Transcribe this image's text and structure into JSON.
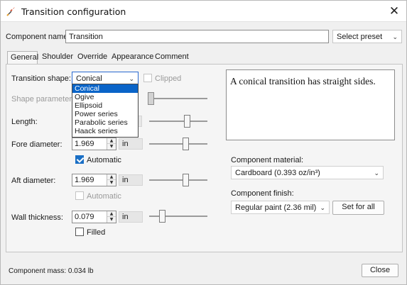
{
  "window": {
    "title": "Transition configuration",
    "close_symbol": "✕",
    "app_icon": "rocket-icon"
  },
  "component_name": {
    "label": "Component name:",
    "value": "Transition"
  },
  "preset": {
    "label": "Select preset",
    "chevron": "⌄"
  },
  "tabs": [
    {
      "label": "General",
      "active": true
    },
    {
      "label": "Shoulder",
      "active": false
    },
    {
      "label": "Override",
      "active": false
    },
    {
      "label": "Appearance",
      "active": false
    },
    {
      "label": "Comment",
      "active": false
    }
  ],
  "general": {
    "transition_shape": {
      "label": "Transition shape:",
      "value": "Conical",
      "chevron": "⌄",
      "options": [
        "Conical",
        "Ogive",
        "Ellipsoid",
        "Power series",
        "Parabolic series",
        "Haack series"
      ],
      "selected_index": 0
    },
    "clipped": {
      "label": "Clipped",
      "checked": false,
      "enabled": false
    },
    "shape_parameter": {
      "label": "Shape parameter:",
      "enabled": false,
      "slider_fraction": 0.35
    },
    "length": {
      "label": "Length:",
      "slider_fraction": 0.6
    },
    "fore_diameter": {
      "label": "Fore diameter:",
      "value": "1.969",
      "unit": "in",
      "slider_fraction": 0.58,
      "automatic": {
        "label": "Automatic",
        "checked": true,
        "enabled": true
      }
    },
    "aft_diameter": {
      "label": "Aft diameter:",
      "value": "1.969",
      "unit": "in",
      "slider_fraction": 0.58,
      "automatic": {
        "label": "Automatic",
        "checked": false,
        "enabled": false
      }
    },
    "wall_thickness": {
      "label": "Wall thickness:",
      "value": "0.079",
      "unit": "in",
      "slider_fraction": 0.2,
      "filled": {
        "label": "Filled",
        "checked": false
      }
    },
    "description": "A conical transition has straight sides.",
    "material": {
      "label": "Component material:",
      "value": "Cardboard (0.393 oz/in³)",
      "chevron": "⌄"
    },
    "finish": {
      "label": "Component finish:",
      "value": "Regular paint (2.36 mil)",
      "chevron": "⌄"
    },
    "set_for_all": "Set for all"
  },
  "footer": {
    "mass": "Component mass: 0.034 lb",
    "close_button": "Close"
  },
  "spinner": {
    "up": "▲",
    "down": "▼"
  }
}
